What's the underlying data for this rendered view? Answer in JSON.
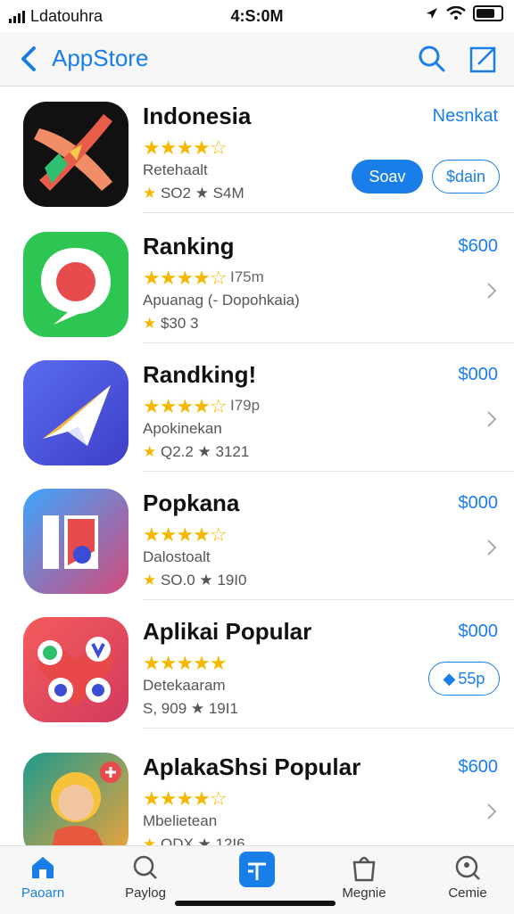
{
  "status_bar": {
    "carrier": "Ldatouhra",
    "time": "4:S:0M"
  },
  "nav": {
    "title": "AppStore"
  },
  "apps": [
    {
      "name": "Indonesia",
      "stars": "★★★★☆",
      "rating_count": "",
      "subtitle": "Retehaalt",
      "meta": "SO2 ★ S4M",
      "price": "Nesnkat",
      "primary_button": "Soav",
      "secondary_button": "$dain"
    },
    {
      "name": "Ranking",
      "stars": "★★★★☆",
      "rating_count": "I75m",
      "subtitle": "Apuanag (- Dopohkaia)",
      "meta": "$30 3",
      "price": "$600",
      "primary_button": "",
      "secondary_button": ""
    },
    {
      "name": "Randking!",
      "stars": "★★★★☆",
      "rating_count": "I79p",
      "subtitle": "Apokinekan",
      "meta": "Q2.2 ★ 3121",
      "price": "$000",
      "primary_button": "",
      "secondary_button": ""
    },
    {
      "name": "Popkana",
      "stars": "★★★★☆",
      "rating_count": "",
      "subtitle": "Dalostoalt",
      "meta": "SO.0 ★ 19I0",
      "price": "$000",
      "primary_button": "",
      "secondary_button": ""
    },
    {
      "name": "Aplikai Popular",
      "stars": "★★★★★",
      "rating_count": "",
      "subtitle": "Detekaaram",
      "meta": "S, 909 ★ 19I1",
      "price": "$000",
      "primary_button": "",
      "secondary_button": "55p"
    },
    {
      "name": "AplakaShsi Popular",
      "stars": "★★★★☆",
      "rating_count": "",
      "subtitle": "Mbelietean",
      "meta": "QDX ★ 12I6",
      "price": "$600",
      "primary_button": "",
      "secondary_button": ""
    }
  ],
  "tabs": [
    {
      "label": "Paoarn",
      "icon": "home-icon",
      "active": true
    },
    {
      "label": "Paylog",
      "icon": "search-icon",
      "active": false
    },
    {
      "label": "",
      "icon": "apps-icon",
      "active": false
    },
    {
      "label": "Megnie",
      "icon": "bag-icon",
      "active": false
    },
    {
      "label": "Cemie",
      "icon": "profile-icon",
      "active": false
    }
  ],
  "colors": {
    "accent": "#1a7ee8",
    "star": "#f5b800"
  }
}
